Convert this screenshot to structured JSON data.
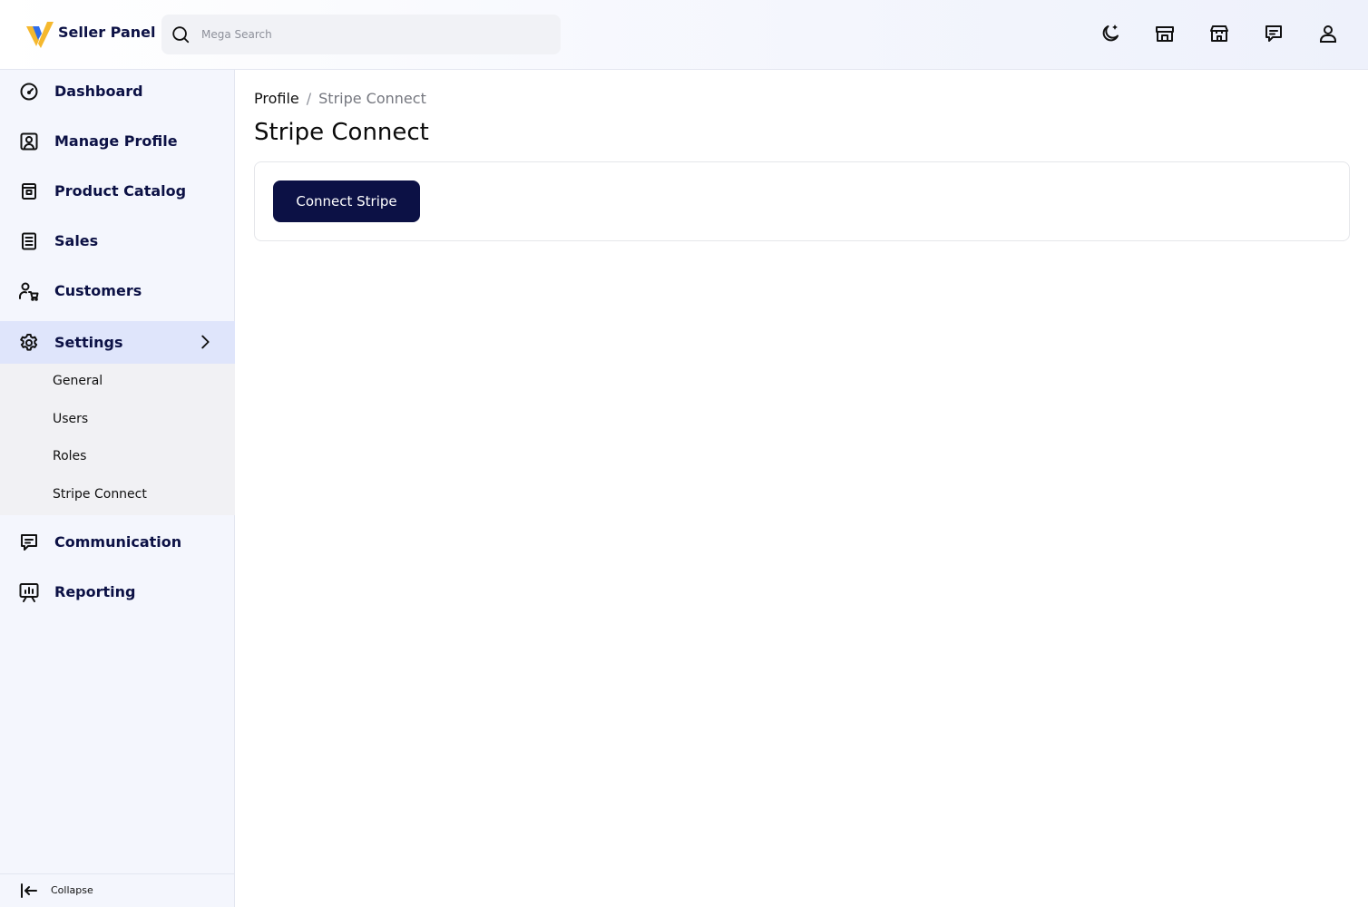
{
  "app": {
    "title": "Seller Panel"
  },
  "colors": {
    "brand": "#0c1145",
    "logo_yellow": "#f5b82e",
    "logo_blue": "#2f6dea",
    "active_bg": "#dfe5fb"
  },
  "search": {
    "placeholder": "Mega Search",
    "icon": "search-icon"
  },
  "header_icons": [
    "theme-toggle-icon",
    "store-icon",
    "building-icon",
    "chat-icon",
    "user-icon"
  ],
  "sidebar": {
    "items": [
      {
        "label": "Dashboard",
        "icon": "gauge-icon"
      },
      {
        "label": "Manage Profile",
        "icon": "profile-icon"
      },
      {
        "label": "Product Catalog",
        "icon": "catalog-icon"
      },
      {
        "label": "Sales",
        "icon": "receipt-icon"
      },
      {
        "label": "Customers",
        "icon": "customers-icon"
      },
      {
        "label": "Settings",
        "icon": "gear-icon",
        "active": true,
        "expanded": true
      },
      {
        "label": "Communication",
        "icon": "chat-icon"
      },
      {
        "label": "Reporting",
        "icon": "presentation-chart-icon"
      }
    ],
    "settings_subitems": [
      "General",
      "Users",
      "Roles",
      "Stripe Connect"
    ],
    "collapse_label": "Collapse"
  },
  "breadcrumb": {
    "parent": "Profile",
    "separator": "/",
    "current": "Stripe Connect"
  },
  "page": {
    "title": "Stripe Connect",
    "connect_button": "Connect Stripe"
  }
}
